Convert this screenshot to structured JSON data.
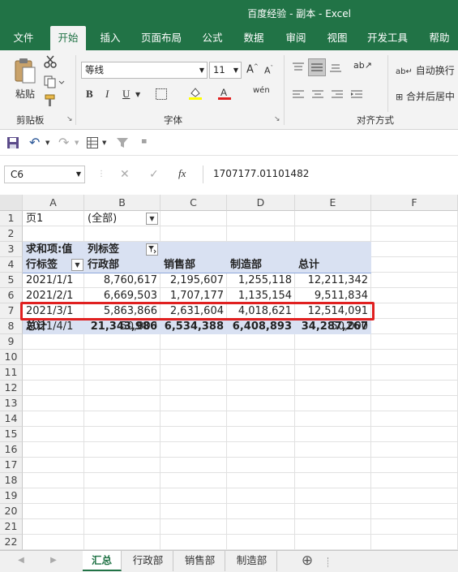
{
  "window": {
    "title": "百度经验 - 副本  -  Excel"
  },
  "ribbon_tabs": [
    "文件",
    "开始",
    "插入",
    "页面布局",
    "公式",
    "数据",
    "审阅",
    "视图",
    "开发工具",
    "帮助"
  ],
  "active_tab": "开始",
  "ribbon": {
    "clipboard": {
      "paste": "粘贴",
      "group": "剪贴板"
    },
    "font": {
      "name": "等线",
      "size": "11",
      "group": "字体",
      "bold": "B",
      "italic": "I",
      "underline": "U"
    },
    "alignment": {
      "wrap": "自动换行",
      "merge": "合并后居中",
      "group": "对齐方式"
    }
  },
  "formula_bar": {
    "name_box": "C6",
    "fx_label": "fx",
    "value": "1707177.01101482"
  },
  "columns": [
    "A",
    "B",
    "C",
    "D",
    "E",
    "F"
  ],
  "rows": [
    "1",
    "2",
    "3",
    "4",
    "5",
    "6",
    "7",
    "8",
    "9",
    "10",
    "11",
    "12",
    "13",
    "14",
    "15",
    "16",
    "17",
    "18",
    "19",
    "20",
    "21",
    "22"
  ],
  "pivot": {
    "page_field": "页1",
    "page_value": "(全部)",
    "values_label": "求和项:值",
    "col_labels": "列标签",
    "row_labels": "行标签",
    "headers": [
      "行政部",
      "销售部",
      "制造部",
      "总计"
    ],
    "data": [
      {
        "label": "2021/1/1",
        "v": [
          "8,760,617",
          "2,195,607",
          "1,255,118",
          "12,211,342"
        ]
      },
      {
        "label": "2021/2/1",
        "v": [
          "6,669,503",
          "1,707,177",
          "1,135,154",
          "9,511,834"
        ]
      },
      {
        "label": "2021/3/1",
        "v": [
          "5,863,866",
          "2,631,604",
          "4,018,621",
          "12,514,091"
        ]
      },
      {
        "label": "2021/4/1",
        "v": [
          "50,000",
          "",
          "",
          "50,000"
        ]
      }
    ],
    "total": {
      "label": "总计",
      "v": [
        "21,343,986",
        "6,534,388",
        "6,408,893",
        "34,287,267"
      ]
    }
  },
  "sheet_tabs": [
    "汇总",
    "行政部",
    "销售部",
    "制造部"
  ],
  "active_sheet": "汇总",
  "colors": {
    "accent": "#217346",
    "pivot_header": "#d9e1f2",
    "highlight": "#e02020"
  }
}
